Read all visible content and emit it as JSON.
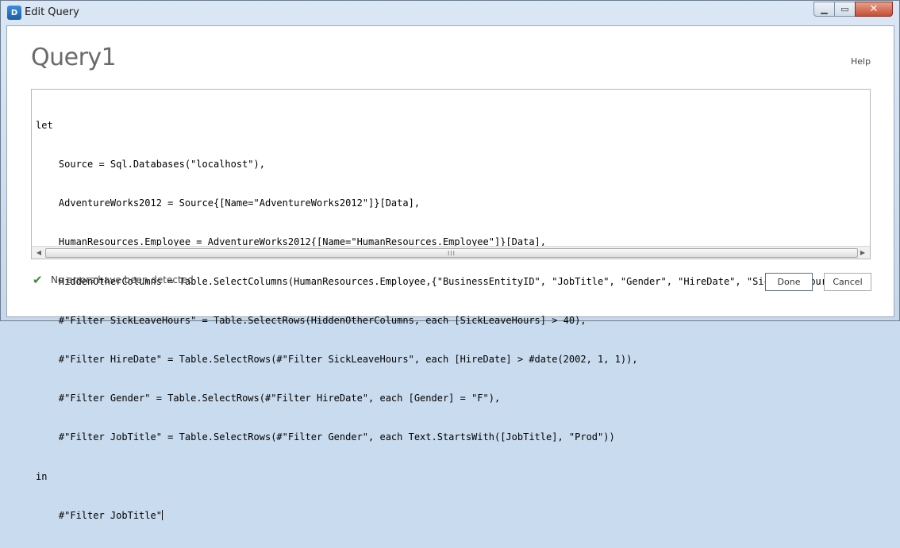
{
  "window": {
    "title": "Edit Query",
    "app_icon_glyph": "D",
    "min_glyph": "▁",
    "max_glyph": "▭",
    "close_glyph": "✕"
  },
  "query": {
    "name": "Query1",
    "help_label": "Help"
  },
  "editor": {
    "lines": [
      "let",
      "    Source = Sql.Databases(\"localhost\"),",
      "    AdventureWorks2012 = Source{[Name=\"AdventureWorks2012\"]}[Data],",
      "    HumanResources.Employee = AdventureWorks2012{[Name=\"HumanResources.Employee\"]}[Data],",
      "    HiddenOtherColumns = Table.SelectColumns(HumanResources.Employee,{\"BusinessEntityID\", \"JobTitle\", \"Gender\", \"HireDate\", \"SickLeaveHours\"}),",
      "    #\"Filter SickLeaveHours\" = Table.SelectRows(HiddenOtherColumns, each [SickLeaveHours] > 40),",
      "    #\"Filter HireDate\" = Table.SelectRows(#\"Filter SickLeaveHours\", each [HireDate] > #date(2002, 1, 1)),",
      "    #\"Filter Gender\" = Table.SelectRows(#\"Filter HireDate\", each [Gender] = \"F\"),",
      "    #\"Filter JobTitle\" = Table.SelectRows(#\"Filter Gender\", each Text.StartsWith([JobTitle], \"Prod\"))",
      "in",
      "    #\"Filter JobTitle\""
    ],
    "scroll_left_glyph": "◀",
    "scroll_right_glyph": "▶",
    "thumb_grip": "III"
  },
  "status": {
    "icon": "check-icon",
    "glyph": "✔",
    "color": "#3a8c3a",
    "message": "No errors have been detected."
  },
  "buttons": {
    "done_label": "Done",
    "cancel_label": "Cancel"
  }
}
